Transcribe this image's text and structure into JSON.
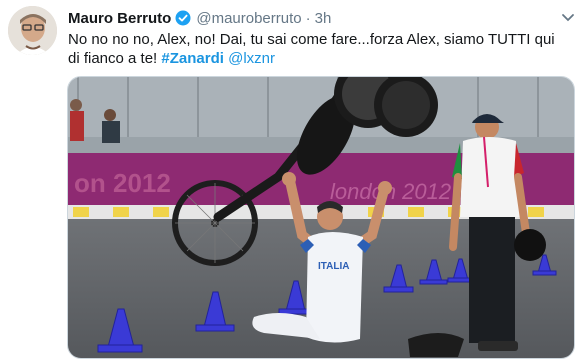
{
  "author": {
    "name": "Mauro Berruto",
    "handle": "@mauroberruto",
    "separator": "·",
    "time": "3h"
  },
  "tweet": {
    "text_main": "No no no no, Alex, no! Dai, tu sai come fare...forza Alex, siamo TUTTI qui di fianco a te! ",
    "hashtag": "#Zanardi",
    "mention": "@lxznr"
  },
  "media": {
    "banner_text_left": "on 2012",
    "banner_text_right": "london 2012",
    "jersey_text": "ITALIA"
  },
  "icons": {
    "verified": "verified-badge-icon",
    "caret": "chevron-down-icon"
  },
  "colors": {
    "link": "#1b95e0",
    "verified": "#1da1f2",
    "banner": "#8e2a72"
  }
}
